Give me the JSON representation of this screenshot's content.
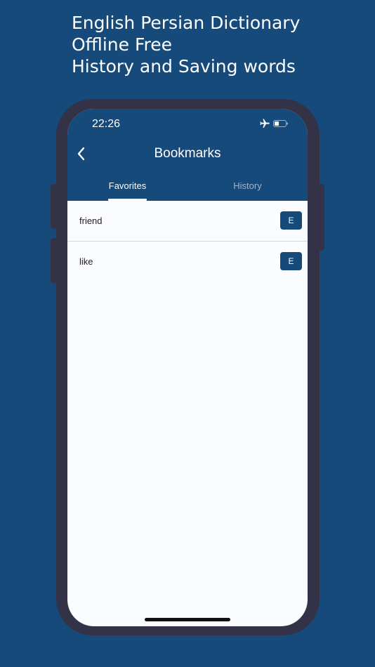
{
  "promo": {
    "line1": "English Persian Dictionary",
    "line2": "Offline Free",
    "line3": "History and Saving words"
  },
  "status_bar": {
    "time": "22:26",
    "icons": [
      "airplane-icon",
      "battery-icon"
    ]
  },
  "header": {
    "title": "Bookmarks",
    "back_icon": "chevron-left-icon"
  },
  "tabs": [
    {
      "label": "Favorites",
      "active": true
    },
    {
      "label": "History",
      "active": false
    }
  ],
  "favorites": [
    {
      "word": "friend",
      "button_label": "E"
    },
    {
      "word": "like",
      "button_label": "E"
    }
  ],
  "colors": {
    "brand": "#154a7a",
    "frame": "#333246",
    "screen_bg": "#fbfcff",
    "inactive_tab": "#9fb6cc"
  }
}
